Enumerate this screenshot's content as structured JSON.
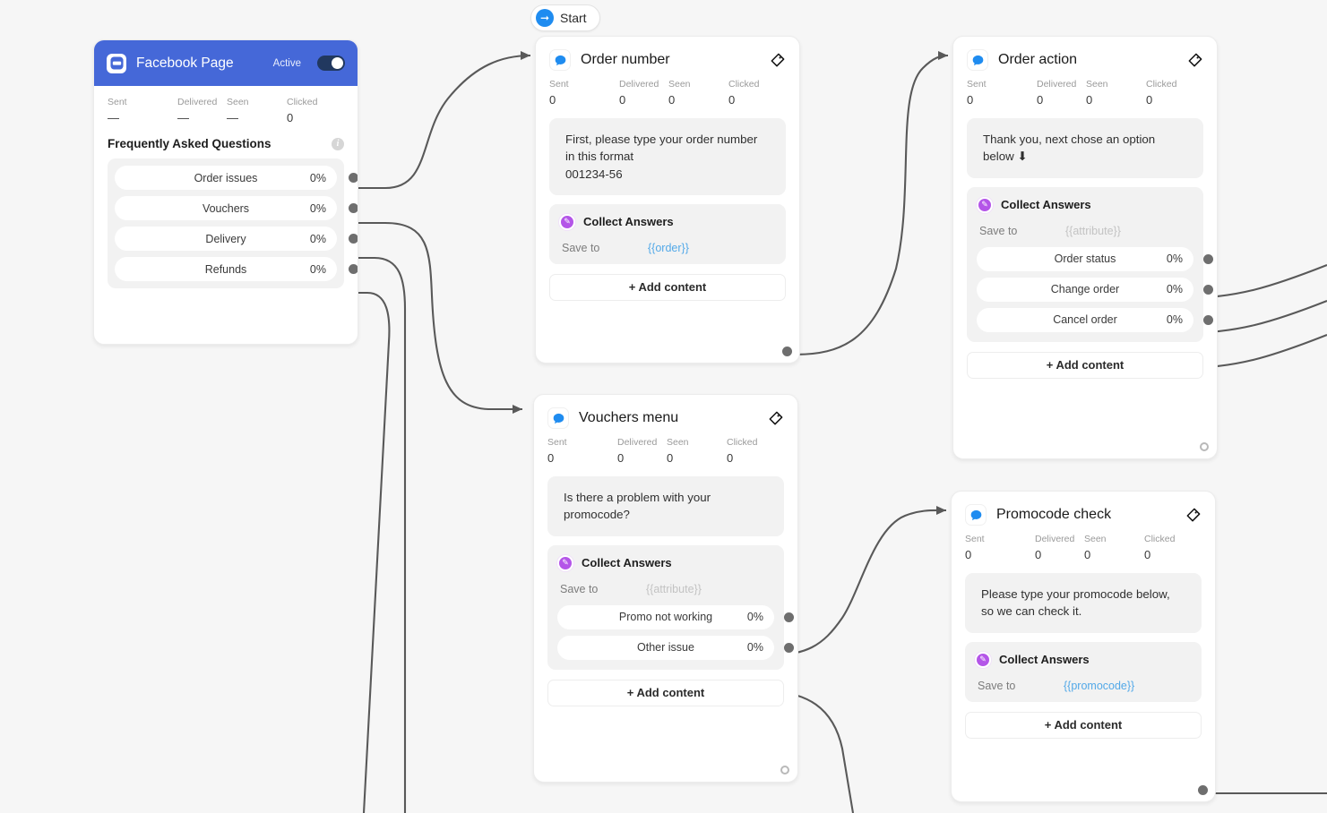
{
  "canvas": {
    "background": "#f6f6f6",
    "wire_color": "#595959"
  },
  "start": {
    "label": "Start",
    "icon": "arrow-right-icon"
  },
  "stats_labels": {
    "sent": "Sent",
    "delivered": "Delivered",
    "seen": "Seen",
    "clicked": "Clicked"
  },
  "common": {
    "add_content": "+ Add content",
    "collect_answers": "Collect Answers",
    "save_to": "Save to"
  },
  "facebook_node": {
    "title": "Facebook Page",
    "icon": "messenger-page-icon",
    "status_label": "Active",
    "toggle_on": true,
    "header_color": "#4568d8",
    "stats": {
      "sent": "—",
      "delivered": "—",
      "seen": "—",
      "clicked": "0"
    },
    "section_title": "Frequently Asked Questions",
    "info_icon": "info-icon",
    "options": [
      {
        "label": "Order issues",
        "pct": "0%"
      },
      {
        "label": "Vouchers",
        "pct": "0%"
      },
      {
        "label": "Delivery",
        "pct": "0%"
      },
      {
        "label": "Refunds",
        "pct": "0%"
      }
    ]
  },
  "order_number_node": {
    "title": "Order number",
    "icon": "chat-bubble-icon",
    "tag_icon": "tag-icon",
    "stats": {
      "sent": "0",
      "delivered": "0",
      "seen": "0",
      "clicked": "0"
    },
    "message": "First, please type your order number in this format\n001234-56",
    "collect": {
      "title": "Collect Answers",
      "save_to_label": "Save to",
      "save_to_value": "{{order}}",
      "is_placeholder": false
    },
    "add_content": "+ Add content"
  },
  "order_action_node": {
    "title": "Order action",
    "icon": "chat-bubble-icon",
    "tag_icon": "tag-icon",
    "stats": {
      "sent": "0",
      "delivered": "0",
      "seen": "0",
      "clicked": "0"
    },
    "message": "Thank you, next chose an option below ⬇",
    "collect": {
      "title": "Collect Answers",
      "save_to_label": "Save to",
      "save_to_value": "{{attribute}}",
      "is_placeholder": true
    },
    "options": [
      {
        "label": "Order status",
        "pct": "0%"
      },
      {
        "label": "Change order",
        "pct": "0%"
      },
      {
        "label": "Cancel order",
        "pct": "0%"
      }
    ],
    "add_content": "+ Add content"
  },
  "vouchers_menu_node": {
    "title": "Vouchers menu",
    "icon": "chat-bubble-icon",
    "tag_icon": "tag-icon",
    "stats": {
      "sent": "0",
      "delivered": "0",
      "seen": "0",
      "clicked": "0"
    },
    "message": "Is there a problem with your promocode?",
    "collect": {
      "title": "Collect Answers",
      "save_to_label": "Save to",
      "save_to_value": "{{attribute}}",
      "is_placeholder": true
    },
    "options": [
      {
        "label": "Promo not working",
        "pct": "0%"
      },
      {
        "label": "Other issue",
        "pct": "0%"
      }
    ],
    "add_content": "+ Add content"
  },
  "promocode_node": {
    "title": "Promocode check",
    "icon": "chat-bubble-icon",
    "tag_icon": "tag-icon",
    "stats": {
      "sent": "0",
      "delivered": "0",
      "seen": "0",
      "clicked": "0"
    },
    "message": "Please type your promocode below, so we can check it.",
    "collect": {
      "title": "Collect Answers",
      "save_to_label": "Save to",
      "save_to_value": "{{promocode}}",
      "is_placeholder": false
    },
    "add_content": "+ Add content"
  }
}
